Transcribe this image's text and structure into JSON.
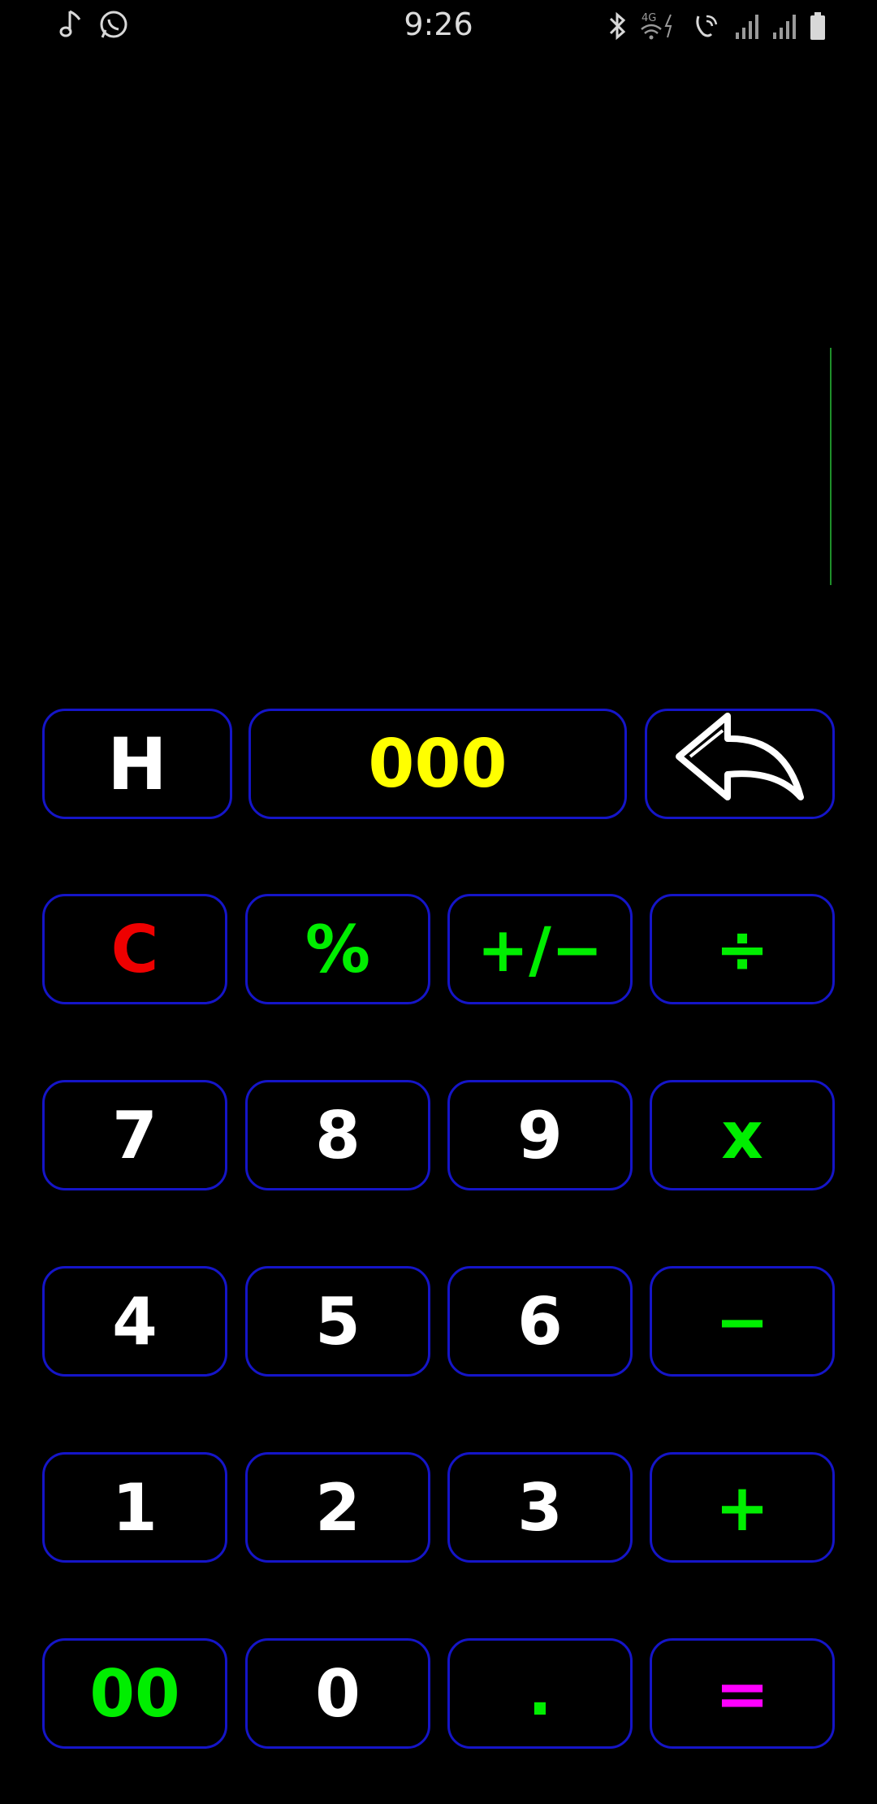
{
  "status_bar": {
    "time": "9:26",
    "left_icons": [
      "music-note-icon",
      "whatsapp-icon"
    ],
    "right_icons": [
      "bluetooth-icon",
      "4g-wifi-icon",
      "wifi-calling-icon",
      "signal-icon",
      "signal-icon",
      "battery-icon"
    ],
    "network_label": "4G"
  },
  "display": {
    "expression": "",
    "result": ""
  },
  "colors": {
    "key_border": "#1515c8",
    "digit": "#ffffff",
    "operator": "#00ee00",
    "clear": "#ee0000",
    "highlight": "#ffff00",
    "equals": "#ff00ff",
    "cursor": "#1f8f2a"
  },
  "keys": {
    "history": "H",
    "triple_zero": "000",
    "clear": "C",
    "percent": "%",
    "plus_minus": "+/−",
    "divide": "÷",
    "seven": "7",
    "eight": "8",
    "nine": "9",
    "multiply": "x",
    "four": "4",
    "five": "5",
    "six": "6",
    "minus": "−",
    "one": "1",
    "two": "2",
    "three": "3",
    "plus": "+",
    "double_zero": "00",
    "zero": "0",
    "decimal": ".",
    "equals": "="
  }
}
